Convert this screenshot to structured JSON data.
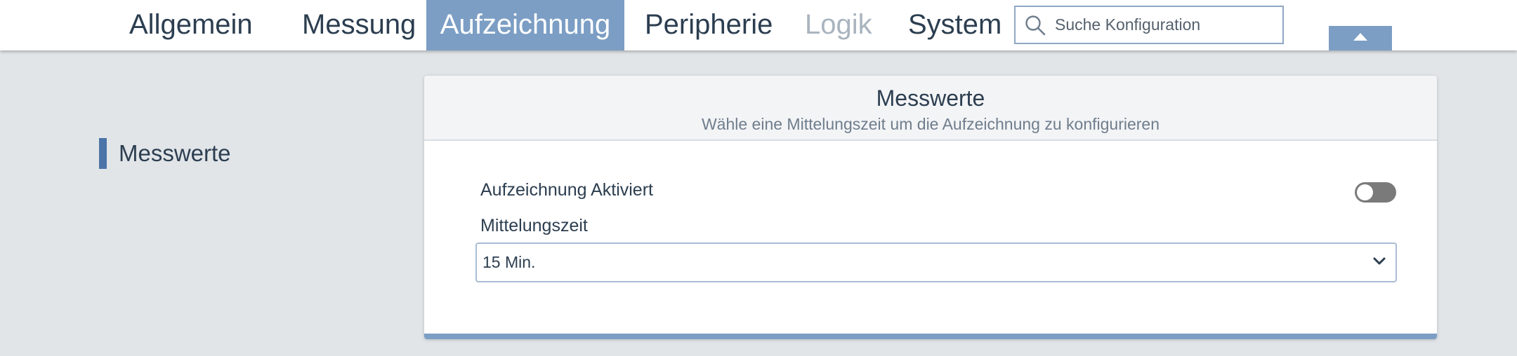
{
  "nav": {
    "tabs": [
      {
        "label": "Allgemein",
        "state": "default"
      },
      {
        "label": "Messung",
        "state": "default"
      },
      {
        "label": "Aufzeichnung",
        "state": "active"
      },
      {
        "label": "Peripherie",
        "state": "default"
      },
      {
        "label": "Logik",
        "state": "disabled"
      },
      {
        "label": "System",
        "state": "default"
      }
    ],
    "search": {
      "placeholder": "Suche Konfiguration",
      "value": "",
      "icon": "search-icon"
    },
    "collapse_icon": "caret-up-icon"
  },
  "sidebar": {
    "items": [
      {
        "label": "Messwerte",
        "active": true
      }
    ]
  },
  "card": {
    "title": "Messwerte",
    "subtitle": "Wähle eine Mittelungszeit um die Aufzeichnung zu konfigurieren",
    "toggle": {
      "label": "Aufzeichnung Aktiviert",
      "checked": false
    },
    "select": {
      "label": "Mittelungszeit",
      "value": "15 Min.",
      "icon": "chevron-down-icon"
    }
  },
  "colors": {
    "accent": "#7c9ec4",
    "sidebar_marker": "#4c74a8",
    "text": "#2c3e50",
    "background": "#e1e5e8",
    "toggle_off": "#7a7a7a",
    "disabled_text": "#a9b4bf"
  }
}
